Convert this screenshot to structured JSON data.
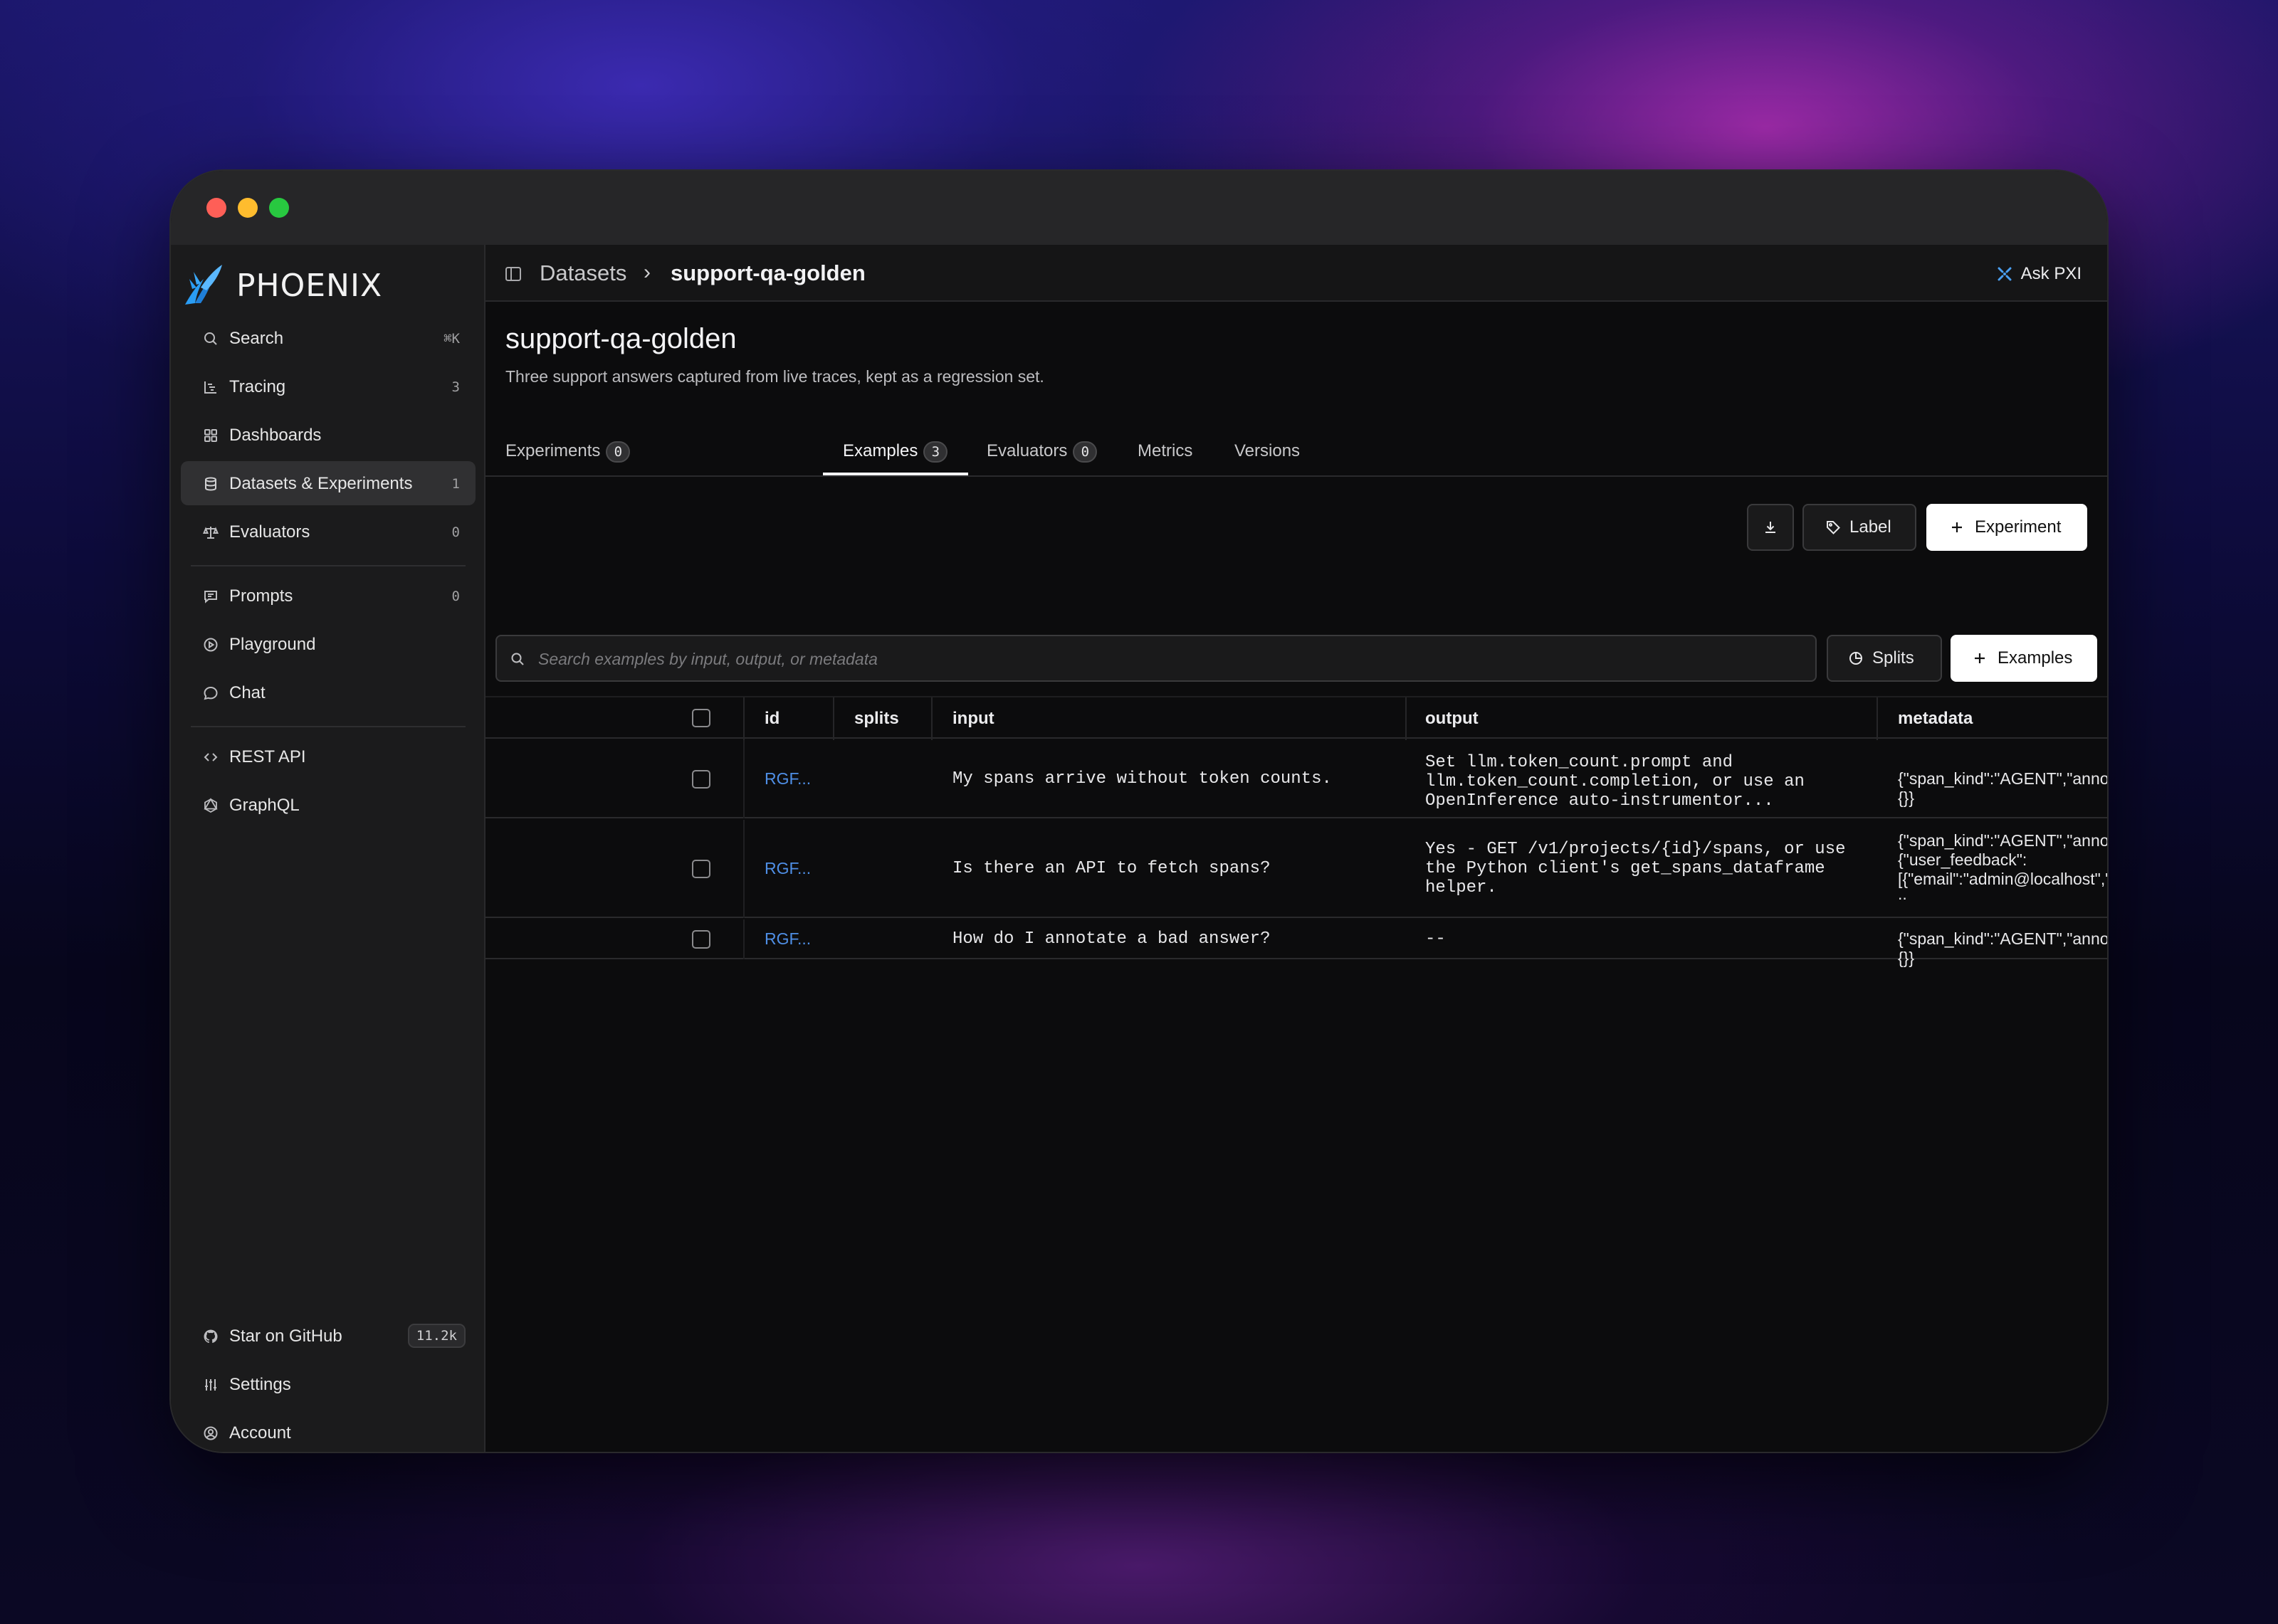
{
  "app": {
    "name": "PHOENIX"
  },
  "sidebar": {
    "items": [
      {
        "label": "Search",
        "count": "⌘K"
      },
      {
        "label": "Tracing",
        "count": "3"
      },
      {
        "label": "Dashboards",
        "count": ""
      },
      {
        "label": "Datasets & Experiments",
        "count": "1"
      },
      {
        "label": "Evaluators",
        "count": "0"
      },
      {
        "label": "Prompts",
        "count": "0"
      },
      {
        "label": "Playground",
        "count": ""
      },
      {
        "label": "Chat",
        "count": ""
      },
      {
        "label": "REST API",
        "count": ""
      },
      {
        "label": "GraphQL",
        "count": ""
      }
    ],
    "footer": [
      {
        "label": "Star on GitHub",
        "count": "11.2k"
      },
      {
        "label": "Settings"
      },
      {
        "label": "Account"
      }
    ]
  },
  "breadcrumb": {
    "parent": "Datasets",
    "current": "support-qa-golden"
  },
  "header": {
    "ask_label": "Ask PXI"
  },
  "page": {
    "title": "support-qa-golden",
    "description": "Three support answers captured from live traces, kept as a regression set."
  },
  "actions": {
    "label_button": "Label",
    "experiment_button": "Experiment"
  },
  "tabs": [
    {
      "label": "Experiments",
      "count": "0"
    },
    {
      "label": "Examples",
      "count": "3"
    },
    {
      "label": "Evaluators",
      "count": "0"
    },
    {
      "label": "Metrics"
    },
    {
      "label": "Versions"
    }
  ],
  "search": {
    "placeholder": "Search examples by input, output, or metadata"
  },
  "toolbar": {
    "splits_button": "Splits",
    "examples_button": "Examples"
  },
  "table": {
    "columns": [
      "id",
      "splits",
      "input",
      "output",
      "metadata"
    ],
    "rows": [
      {
        "id": "RGF...",
        "splits": "",
        "input": "My spans arrive without token counts.",
        "output": [
          "Set llm.token_count.prompt and",
          "llm.token_count.completion, or use an",
          "OpenInference auto-instrumentor..."
        ],
        "metadata": [
          "{\"span_kind\":\"AGENT\",\"annotations\":{}}"
        ]
      },
      {
        "id": "RGF...",
        "splits": "",
        "input": "Is there an API to fetch spans?",
        "output": [
          "Yes - GET /v1/projects/{id}/spans, or use",
          "the Python client's get_spans_dataframe",
          "helper."
        ],
        "metadata": [
          "{\"span_kind\":\"AGENT\",\"annotations\":",
          "{\"user_feedback\":",
          "[{\"email\":\"admin@localhost\",\"label\":\"positive\",\".",
          ".."
        ]
      },
      {
        "id": "RGF...",
        "splits": "",
        "input": "How do I annotate a bad answer?",
        "output": [
          "--"
        ],
        "metadata": [
          "{\"span_kind\":\"AGENT\",\"annotations\":{}}"
        ]
      }
    ]
  }
}
